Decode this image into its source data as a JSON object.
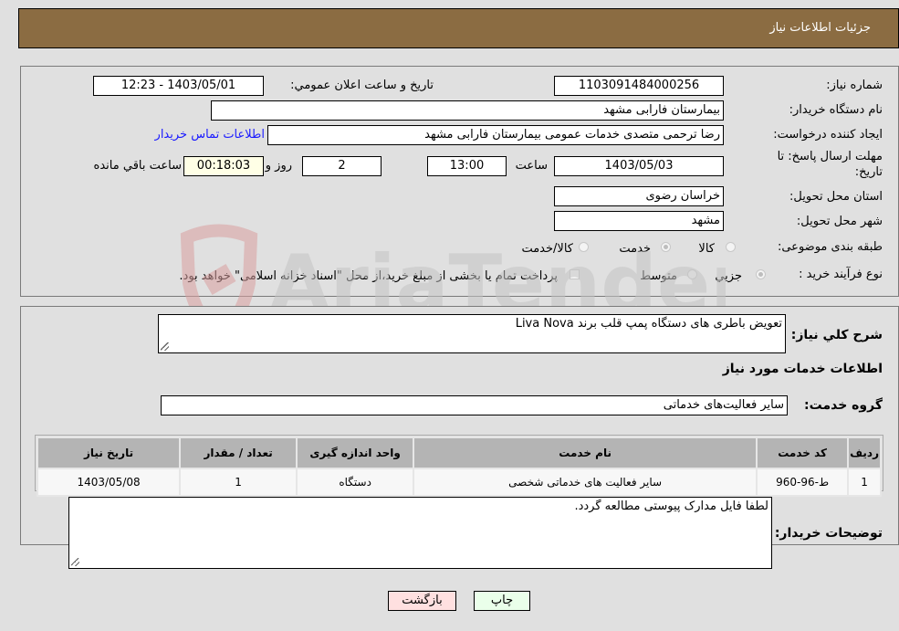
{
  "header": {
    "title": "جزئیات اطلاعات نیاز"
  },
  "details": {
    "need_number_label": "شماره نیاز:",
    "need_number": "1103091484000256",
    "announce_label": "تاریخ و ساعت اعلان عمومي:",
    "announce_value": "1403/05/01 - 12:23",
    "buyer_org_label": "نام دستگاه خریدار:",
    "buyer_org": "بیمارستان فارابی مشهد",
    "requester_label": "ایجاد کننده درخواست:",
    "requester": "رضا ترحمی متصدی خدمات عمومی بیمارستان فارابی مشهد",
    "contact_link": "اطلاعات تماس خریدار",
    "deadline_label_1": "مهلت ارسال پاسخ: تا",
    "deadline_label_2": "تاریخ:",
    "deadline_date": "1403/05/03",
    "time_label": "ساعت",
    "deadline_time": "13:00",
    "days": "2",
    "days_label": "روز و",
    "remaining": "00:18:03",
    "remaining_label": "ساعت باقي مانده",
    "province_label": "استان محل تحویل:",
    "province": "خراسان رضوی",
    "city_label": "شهر محل تحویل:",
    "city": "مشهد",
    "category_label": "طبقه بندی موضوعی:",
    "category_options": [
      {
        "label": "کالا",
        "checked": false
      },
      {
        "label": "خدمت",
        "checked": true
      },
      {
        "label": "کالا/خدمت",
        "checked": false
      }
    ],
    "process_label": "نوع فرآیند خرید :",
    "process_options": [
      {
        "label": "جزيي",
        "checked": true
      },
      {
        "label": "متوسط",
        "checked": false
      }
    ],
    "treasury_note": "پرداخت تمام یا بخشی از مبلغ خرید،از محل \"اسناد خزانه اسلامی\" خواهد بود."
  },
  "description": {
    "label": "شرح كلي نياز:",
    "value": "تعویض باطری های دستگاه پمپ قلب برند Liva Nova"
  },
  "services": {
    "section_title": "اطلاعات خدمات مورد نیاز",
    "group_label": "گروه خدمت:",
    "group_value": "سایر فعالیت‌های خدماتی",
    "table": {
      "headers": [
        "ردیف",
        "کد خدمت",
        "نام خدمت",
        "واحد اندازه گیری",
        "تعداد / مقدار",
        "تاریخ نیاز"
      ],
      "rows": [
        [
          "1",
          "ط-96-960",
          "سایر فعالیت های خدماتی شخصی",
          "دستگاه",
          "1",
          "1403/05/08"
        ]
      ]
    }
  },
  "buyer_notes": {
    "label": "توضیحات خریدار:",
    "value": "لطفا فایل مدارک پیوستی مطالعه گردد."
  },
  "buttons": {
    "print": "چاپ",
    "back": "بازگشت"
  },
  "watermark": {
    "text": "AriaTender.neT"
  }
}
